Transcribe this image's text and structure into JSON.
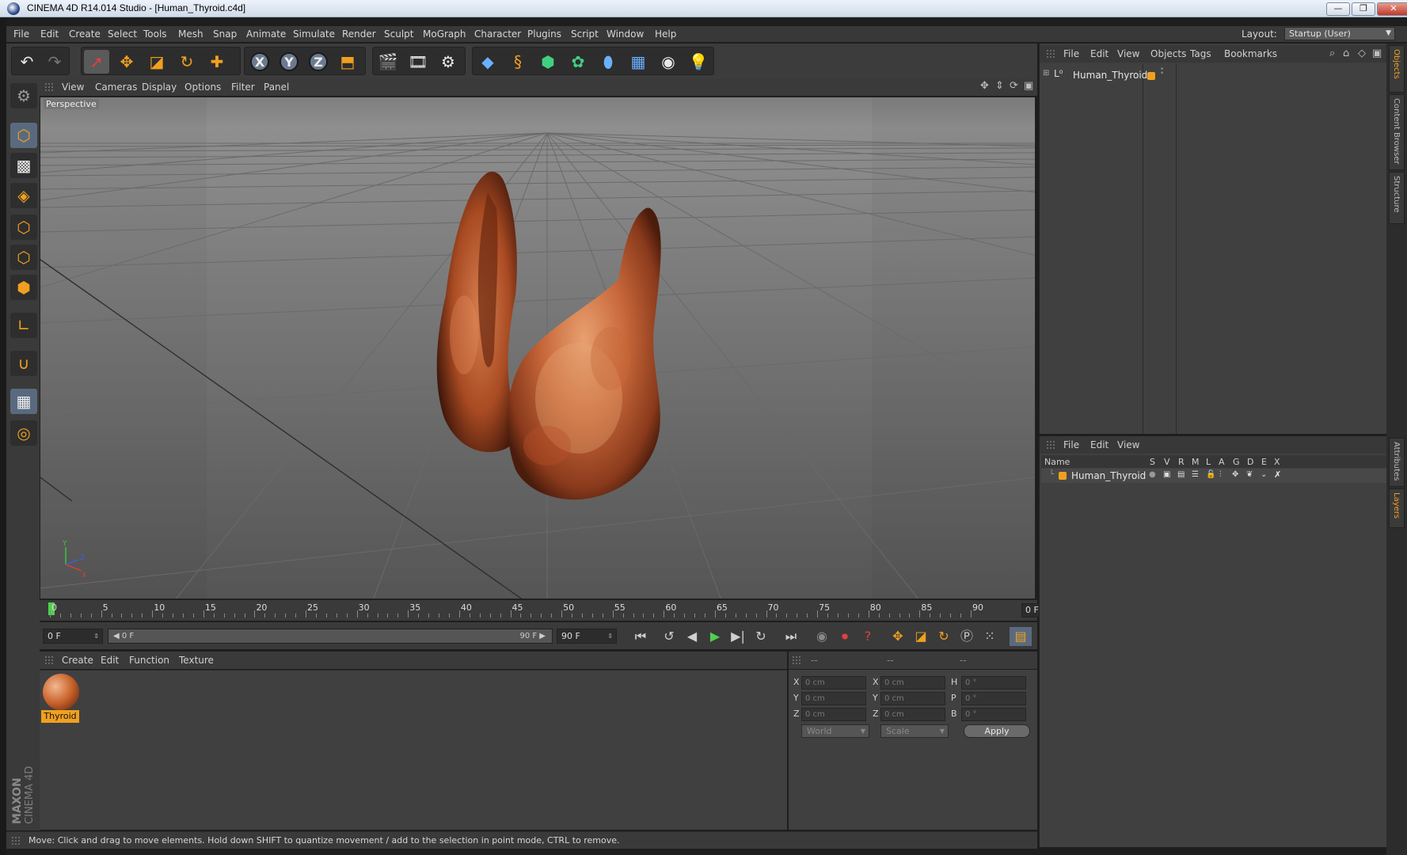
{
  "window": {
    "title": "CINEMA 4D R14.014 Studio - [Human_Thyroid.c4d]",
    "minimize": "—",
    "restore": "❐",
    "close": "✕"
  },
  "menubar": {
    "items": [
      "File",
      "Edit",
      "Create",
      "Select",
      "Tools",
      "Mesh",
      "Snap",
      "Animate",
      "Simulate",
      "Render",
      "Sculpt",
      "MoGraph",
      "Character",
      "Plugins",
      "Script",
      "Window",
      "Help"
    ],
    "layout_label": "Layout:",
    "layout_value": "Startup (User)"
  },
  "viewport": {
    "menu": [
      "View",
      "Cameras",
      "Display",
      "Options",
      "Filter",
      "Panel"
    ],
    "label": "Perspective",
    "nav_icons": [
      "move-view-icon",
      "dolly-view-icon",
      "rotate-view-icon",
      "maximize-view-icon"
    ],
    "axis_y": "Y",
    "axis_x": "X",
    "axis_z": "Z"
  },
  "timeline": {
    "ticks": [
      "0",
      "5",
      "10",
      "15",
      "20",
      "25",
      "30",
      "35",
      "40",
      "45",
      "50",
      "55",
      "60",
      "65",
      "70",
      "75",
      "80",
      "85",
      "90"
    ],
    "current_frame": "0 F"
  },
  "playback": {
    "start_field": "0 F",
    "range_start": "0 F",
    "range_end": "90 F",
    "end_field": "90 F"
  },
  "material_manager": {
    "menu": [
      "Create",
      "Edit",
      "Function",
      "Texture"
    ],
    "material_name": "Thyroid"
  },
  "coordinates": {
    "headers": [
      "--",
      "--",
      "--"
    ],
    "pos_labels": [
      "X",
      "Y",
      "Z"
    ],
    "size_labels": [
      "X",
      "Y",
      "Z"
    ],
    "rot_labels": [
      "H",
      "P",
      "B"
    ],
    "pos_values": [
      "0 cm",
      "0 cm",
      "0 cm"
    ],
    "size_values": [
      "0 cm",
      "0 cm",
      "0 cm"
    ],
    "rot_values": [
      "0 °",
      "0 °",
      "0 °"
    ],
    "mode_select": "World",
    "transform_select": "Scale",
    "apply_label": "Apply"
  },
  "status": {
    "text": "Move: Click and drag to move elements. Hold down SHIFT to quantize movement / add to the selection in point mode, CTRL to remove."
  },
  "object_manager": {
    "menu": [
      "File",
      "Edit",
      "View",
      "Objects",
      "Tags",
      "Bookmarks"
    ],
    "object_name": "Human_Thyroid"
  },
  "layer_manager": {
    "menu": [
      "File",
      "Edit",
      "View"
    ],
    "columns": [
      "Name",
      "S",
      "V",
      "R",
      "M",
      "L",
      "A",
      "G",
      "D",
      "E",
      "X"
    ],
    "layer_name": "Human_Thyroid"
  },
  "right_tabs": [
    "Objects",
    "Content Browser",
    "Structure",
    "Attributes",
    "Layers"
  ],
  "logo": {
    "line1": "MAXON",
    "line2": "CINEMA 4D"
  },
  "colors": {
    "accent": "#f0a020",
    "ui_dark": "#3a3a3a",
    "viewport_bg": "#7c7c7c",
    "play_green": "#50d050"
  }
}
